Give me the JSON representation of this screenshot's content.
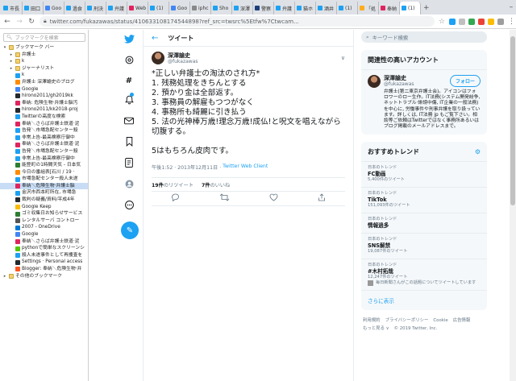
{
  "browser": {
    "tabs": [
      {
        "label": "市長",
        "color": "#1da1f2"
      },
      {
        "label": "田口",
        "color": "#1da1f2"
      },
      {
        "label": "Goo",
        "color": "#4285f4"
      },
      {
        "label": "過食",
        "color": "#1da1f2"
      },
      {
        "label": "刑決",
        "color": "#1da1f2"
      },
      {
        "label": "弁護",
        "color": "#1da1f2"
      },
      {
        "label": "Web",
        "color": "#e0245e"
      },
      {
        "label": "(1)",
        "color": "#1da1f2"
      },
      {
        "label": "Goo",
        "color": "#4285f4"
      },
      {
        "label": "iphc",
        "color": "#888888"
      },
      {
        "label": "Sho",
        "color": "#1da1f2"
      },
      {
        "label": "深澤",
        "color": "#1da1f2"
      },
      {
        "label": "警察",
        "color": "#1d3f7a"
      },
      {
        "label": "弁護",
        "color": "#1da1f2"
      },
      {
        "label": "猫ホ",
        "color": "#1da1f2"
      },
      {
        "label": "酒井",
        "color": "#1da1f2"
      },
      {
        "label": "(1)",
        "color": "#1da1f2"
      },
      {
        "label": "「処",
        "color": "#ffad1f"
      },
      {
        "label": "奉納",
        "color": "#e0245e"
      },
      {
        "label": "(1)",
        "color": "#1da1f2"
      }
    ],
    "new_tab": "+",
    "minimize": "–",
    "url": "twitter.com/fukazawas/status/410633108174544898?ref_src=twsrc%5Etfw%7Ctwcam...",
    "extension_colors": [
      "#1da1f2",
      "#c0c0c0",
      "#34a853",
      "#ea4335",
      "#fbbc05",
      "#9e9e9e"
    ]
  },
  "bookmarks": {
    "search_placeholder": "ブックマークを検索",
    "items": [
      {
        "label": "ブックマーク バー",
        "indent": 0,
        "toggle": "▾",
        "folder": true
      },
      {
        "label": "弁護士",
        "indent": 1,
        "toggle": "▸",
        "folder": true
      },
      {
        "label": "k",
        "indent": 1,
        "toggle": "▸",
        "folder": true
      },
      {
        "label": "ジャーナリスト",
        "indent": 1,
        "toggle": "▸",
        "folder": true
      },
      {
        "label": "k",
        "indent": 1,
        "toggle": "",
        "folder": false,
        "color": "#1da1f2"
      },
      {
        "label": "弁護士 深澤諭史のブログ",
        "indent": 1,
        "toggle": "",
        "folder": false,
        "color": "#ff8c00"
      },
      {
        "label": "Google",
        "indent": 1,
        "toggle": "",
        "folder": false,
        "color": "#4285f4"
      },
      {
        "label": "hirono2011/gh2019kk",
        "indent": 1,
        "toggle": "",
        "folder": false,
        "color": "#24292e"
      },
      {
        "label": "奉納: 危険生物·弁護士脳汚",
        "indent": 1,
        "toggle": "",
        "folder": false,
        "color": "#e0245e"
      },
      {
        "label": "hirono2011/kk2018-proj",
        "indent": 1,
        "toggle": "",
        "folder": false,
        "color": "#24292e"
      },
      {
        "label": "Twitterの高度な検索",
        "indent": 1,
        "toggle": "",
        "folder": false,
        "color": "#1da1f2"
      },
      {
        "label": "奉納＼さらば弁護士鉄道·泥",
        "indent": 1,
        "toggle": "",
        "folder": false,
        "color": "#e0245e"
      },
      {
        "label": "告発＼市場急配センター殺",
        "indent": 1,
        "toggle": "",
        "folder": false,
        "color": "#1da1f2"
      },
      {
        "label": "非常上告-最高検察庁御中",
        "indent": 1,
        "toggle": "",
        "folder": false,
        "color": "#1da1f2"
      },
      {
        "label": "奉納＼さらば弁護士鉄道·泥",
        "indent": 1,
        "toggle": "",
        "folder": false,
        "color": "#e0245e"
      },
      {
        "label": "告発＼市場急配センター殺",
        "indent": 1,
        "toggle": "",
        "folder": false,
        "color": "#1da1f2"
      },
      {
        "label": "非常上告-最高検察庁御中",
        "indent": 1,
        "toggle": "",
        "folder": false,
        "color": "#1da1f2"
      },
      {
        "label": "能登町の1時間天気 - 日本気",
        "indent": 1,
        "toggle": "",
        "folder": false,
        "color": "#2e7d32"
      },
      {
        "label": "今日の番組表[石川 / 19 ·",
        "indent": 1,
        "toggle": "",
        "folder": false,
        "color": "#ff8c00"
      },
      {
        "label": "市場急配センター殺人未遂",
        "indent": 1,
        "toggle": "",
        "folder": false,
        "color": "#1da1f2"
      },
      {
        "label": "奉納＼危険生物·弁護士脳",
        "indent": 1,
        "toggle": "",
        "folder": false,
        "color": "#e0245e",
        "selected": true
      },
      {
        "label": "金沢市西本町所在, 市場急",
        "indent": 1,
        "toggle": "",
        "folder": false,
        "color": "#1da1f2"
      },
      {
        "label": "裁判の疑義/資料/平成4年",
        "indent": 1,
        "toggle": "",
        "folder": false,
        "color": "#24292e"
      },
      {
        "label": "Google Keep",
        "indent": 1,
        "toggle": "",
        "folder": false,
        "color": "#fbbc05"
      },
      {
        "label": "ゴミ収集日お知らせサービス",
        "indent": 1,
        "toggle": "",
        "folder": false,
        "color": "#2e7d32"
      },
      {
        "label": "レンタルサーバ コントロー",
        "indent": 1,
        "toggle": "",
        "folder": false,
        "color": "#555555"
      },
      {
        "label": "2007 - OneDrive",
        "indent": 1,
        "toggle": "",
        "folder": false,
        "color": "#0078d4"
      },
      {
        "label": "Google",
        "indent": 1,
        "toggle": "",
        "folder": false,
        "color": "#4285f4"
      },
      {
        "label": "奉納＼さらば弁護士鉄道·泥",
        "indent": 1,
        "toggle": "",
        "folder": false,
        "color": "#e0245e"
      },
      {
        "label": "pythonで簡単なスクリーンシ",
        "indent": 1,
        "toggle": "",
        "folder": false,
        "color": "#55c500"
      },
      {
        "label": "殺人未遂事件として再捜査を",
        "indent": 1,
        "toggle": "",
        "folder": false,
        "color": "#1da1f2"
      },
      {
        "label": "Settings · Personal access",
        "indent": 1,
        "toggle": "",
        "folder": false,
        "color": "#24292e"
      },
      {
        "label": "Blogger: 奉納＼危険生物·弁",
        "indent": 1,
        "toggle": "",
        "folder": false,
        "color": "#ff5722"
      },
      {
        "label": "その他のブックマーク",
        "indent": 0,
        "toggle": "▸",
        "folder": true
      }
    ]
  },
  "twitter_nav": {
    "icons": [
      "bird-logo-icon",
      "explore-icon",
      "hashtag-icon",
      "notifications-icon",
      "messages-icon",
      "bookmarks-icon",
      "lists-icon",
      "profile-icon",
      "more-icon"
    ],
    "compose_glyph": "✎"
  },
  "main": {
    "header_title": "ツイート",
    "back_glyph": "←",
    "tweet": {
      "author_name": "深澤諭史",
      "author_handle": "@fukazawas",
      "caret": "∨",
      "text": "*正しい弁護士の淘汰のされ方*\n1. 残務処理をきちんとする\n2. 預かり金は全部返す。\n3. 事務員の解雇もつつがなく\n4. 事務所も綺麗に引き払う\n5. 法の光神棒万歳!理念万歳!成仏!と呪文を唱えながら切腹する。\n\n5はもちろん皮肉です。",
      "time": "午後1:52 · 2013年12月11日 ·",
      "source": "Twitter Web Client",
      "retweet_count": "19件",
      "retweet_label": "のリツイート",
      "like_count": "7件",
      "like_label": "のいいね",
      "actions": [
        "reply-icon",
        "retweet-icon",
        "like-icon",
        "share-icon"
      ]
    }
  },
  "right": {
    "search_placeholder": "キーワード検索",
    "related_title": "関連性の高いアカウント",
    "account": {
      "name": "深澤諭史",
      "handle": "@fukazawas",
      "follow_label": "フォロー",
      "bio": "弁護士(第二東京弁護士会)。アイコンはフォロワーのロー生作。IT法務(システム開発紛争, ネットトラブル·誹謗中傷, IT企業の一般法務)を中心に, 労働事件や刑事弁護を取り扱っています。詳しくは, IT法務 jp もご覧下さい。相談等ご依頼はTwitterではなく事務所あるいはブログ掲載のメールアドレスまで。"
    },
    "trends_title": "おすすめトレンド",
    "trends": [
      {
        "category": "日本のトレンド",
        "name": "FC動画",
        "count": "5,400件のツイート"
      },
      {
        "category": "日本のトレンド",
        "name": "TikTok",
        "count": "151,093件のツイート"
      },
      {
        "category": "日本のトレンド",
        "name": "情報過多",
        "count": ""
      },
      {
        "category": "日本のトレンド",
        "name": "SNS解禁",
        "count": "19,087件のツイート"
      },
      {
        "category": "日本のトレンド",
        "name": "#木村拓哉",
        "count": "12,247件のツイート"
      }
    ],
    "trend_news": "毎日新聞さんがこの話題についてツイートしています",
    "show_more": "さらに表示",
    "footer": {
      "line1": [
        "利用規約",
        "プライバシーポリシー",
        "Cookie",
        "広告情報"
      ],
      "line2": [
        "もっと見る ∨",
        "© 2019 Twitter, Inc."
      ]
    }
  }
}
